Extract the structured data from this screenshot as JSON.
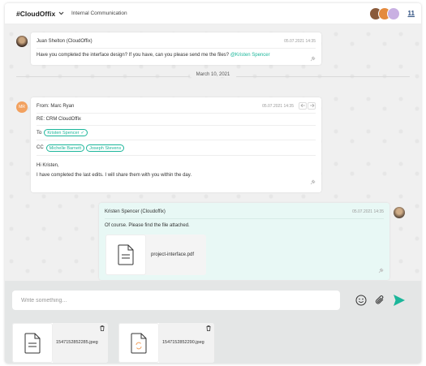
{
  "header": {
    "channel": "#CloudOffix",
    "subtitle": "Internal Communication",
    "member_count": "11"
  },
  "messages": {
    "m1": {
      "sender": "Juan Shelton (CloudOffix)",
      "time": "05.07.2021 14:35",
      "text": "Have you completed the interface design? If you have, can you please send me the files?",
      "mention": "@Kristen Spencer"
    },
    "date_separator": "March 10, 2021",
    "m2": {
      "avatar_initials": "MR",
      "from": "From: Marc Ryan",
      "time": "05.07.2021 14:35",
      "subject": "RE: CRM CloudOffix",
      "to_label": "To",
      "to": "Kristen Spencer",
      "cc_label": "CC",
      "cc": [
        "Michelle Barnett",
        "Joseph Stevens"
      ],
      "greeting": "Hi Kristen,",
      "body": "I have completed the last edits. I will share them with you within the day."
    },
    "m3": {
      "sender": "Kristen Spencer (Cloudoffix)",
      "time": "05.07.2021 14:35",
      "text": "Of course. Please find the file attached.",
      "attachment": "project-interface.pdf"
    }
  },
  "composer": {
    "placeholder": "Write something...",
    "uploads": [
      "1547152852285.jpeg",
      "1547152852290.jpeg"
    ]
  },
  "colors": {
    "accent": "#1bb69a",
    "send": "#1bb69a",
    "bubble_teal": "#e8f8f5"
  }
}
